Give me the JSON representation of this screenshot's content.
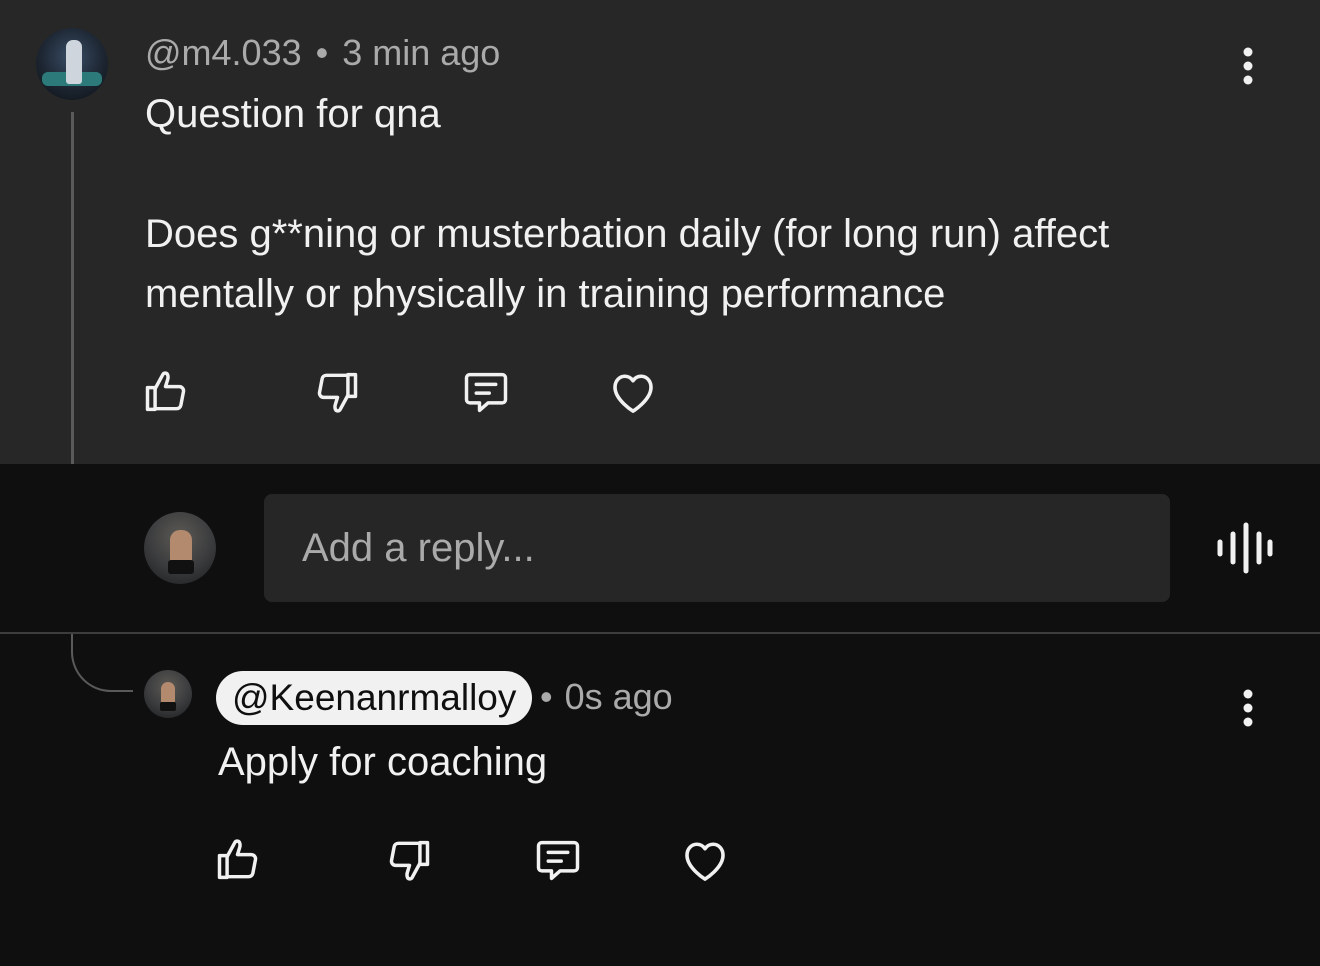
{
  "top_comment": {
    "author": "@m4.033",
    "separator": "•",
    "timestamp": "3 min ago",
    "text": "Question for qna\n\nDoes g**ning or musterbation daily (for long run) affect mentally or physically in training performance",
    "actions": [
      "like-icon",
      "dislike-icon",
      "reply-icon",
      "heart-icon"
    ]
  },
  "reply_box": {
    "placeholder": "Add a reply...",
    "voice_icon": "voice-wave-icon"
  },
  "reply_comment": {
    "author": "@Keenanrmalloy",
    "separator": "•",
    "timestamp": "0s ago",
    "text": "Apply for coaching",
    "actions": [
      "like-icon",
      "dislike-icon",
      "reply-icon",
      "heart-icon"
    ]
  },
  "colors": {
    "top_comment_bg": "#272727",
    "page_bg": "#0f0f0f",
    "input_bg": "#262626",
    "meta_text": "#aaaaaa",
    "primary_text": "#f1f1f1",
    "chip_bg": "#f1f1f1"
  }
}
